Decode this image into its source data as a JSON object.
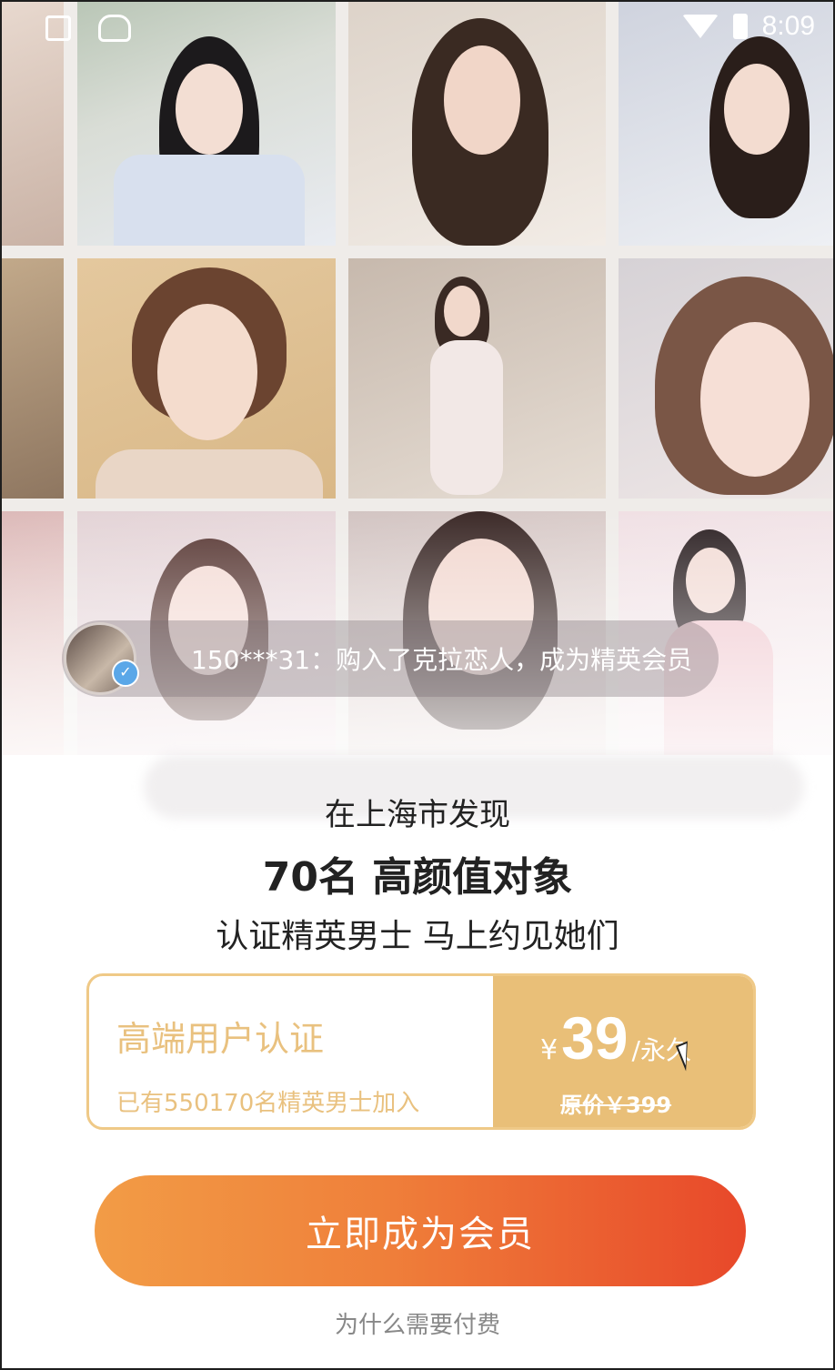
{
  "status_bar": {
    "time": "8:09",
    "icons": [
      "sim-icon",
      "android-icon",
      "wifi-icon",
      "battery-icon"
    ]
  },
  "toast": {
    "text": "150***31：购入了克拉恋人，成为精英会员"
  },
  "headline": {
    "line1": "在上海市发现",
    "line2": "70名 高颜值对象",
    "line3": "认证精英男士 马上约见她们"
  },
  "offer": {
    "title": "高端用户认证",
    "subtitle": "已有550170名精英男士加入",
    "currency": "¥",
    "price": "39",
    "unit": "/永久",
    "original_price": "原价￥399"
  },
  "cta": {
    "label": "立即成为会员"
  },
  "why_link": {
    "label": "为什么需要付费"
  },
  "colors": {
    "accent_gold": "#e9bf78",
    "cta_start": "#f29c46",
    "cta_end": "#e8482a"
  }
}
